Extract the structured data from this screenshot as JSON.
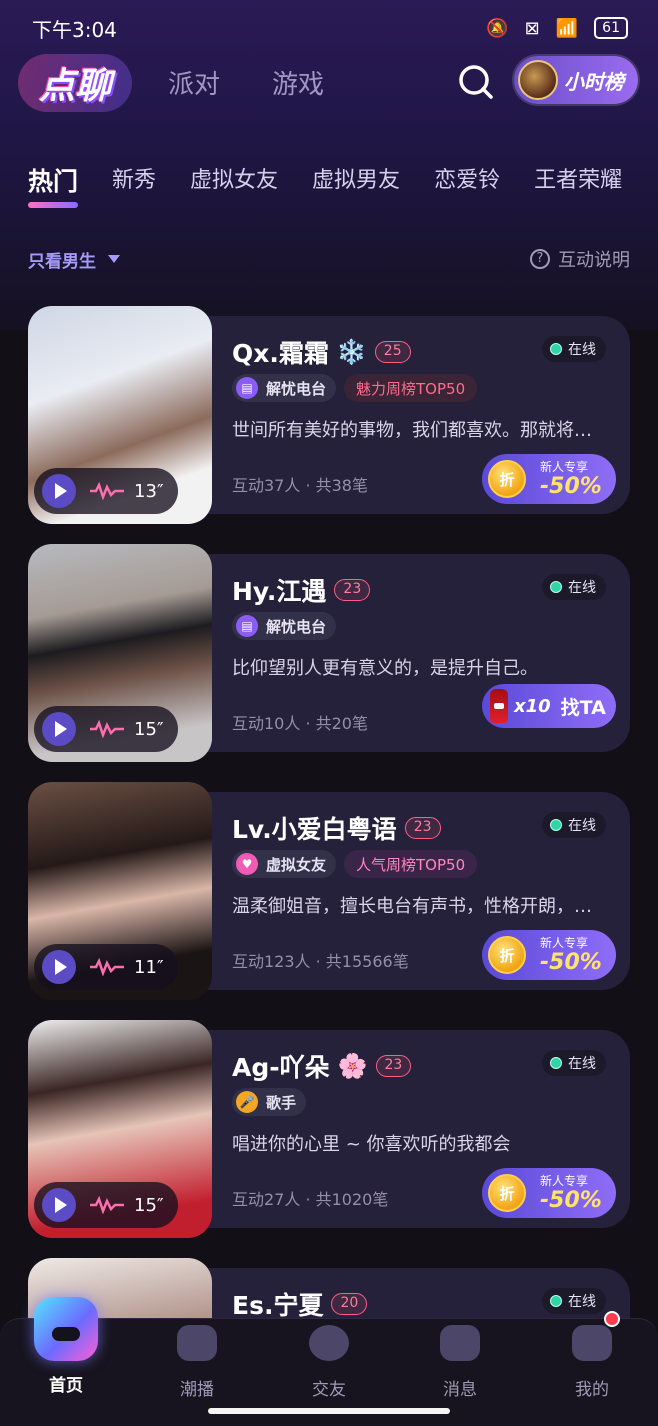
{
  "status_bar": {
    "time": "下午3:04",
    "battery": "61"
  },
  "header": {
    "logo": "点聊",
    "nav": [
      "派对",
      "游戏"
    ],
    "rank_label": "小时榜"
  },
  "categories": [
    "热门",
    "新秀",
    "虚拟女友",
    "虚拟男友",
    "恋爱铃",
    "王者荣耀"
  ],
  "filter": {
    "gender": "只看男生",
    "help": "互动说明"
  },
  "cards": [
    {
      "name": "Qx.霜霜",
      "emoji": "❄️",
      "level": "25",
      "online": "在线",
      "tags": [
        "解忧电台"
      ],
      "rank_tag": "魅力周榜TOP50",
      "desc": "世间所有美好的事物，我们都喜欢。那就将…",
      "stats": "互动37人 · 共38笔",
      "duration": "13″",
      "promo_sub": "新人专享",
      "promo_main": "-50%"
    },
    {
      "name": "Hy.江遇",
      "level": "23",
      "online": "在线",
      "tags": [
        "解忧电台"
      ],
      "desc": "比仰望别人更有意义的，是提升自己。",
      "stats": "互动10人 · 共20笔",
      "duration": "15″",
      "promo_count": "x10",
      "promo_label": "找TA"
    },
    {
      "name": "Lv.小爱白粤语",
      "level": "23",
      "online": "在线",
      "tags": [
        "虚拟女友"
      ],
      "rank_tag": "人气周榜TOP50",
      "desc": "温柔御姐音，擅长电台有声书，性格开朗，…",
      "stats": "互动123人 · 共15566笔",
      "duration": "11″",
      "promo_sub": "新人专享",
      "promo_main": "-50%"
    },
    {
      "name": "Ag-吖朵",
      "emoji": "🌸",
      "level": "23",
      "online": "在线",
      "tags": [
        "歌手"
      ],
      "desc": "唱进你的心里 ~ 你喜欢听的我都会",
      "stats": "互动27人 · 共1020笔",
      "duration": "15″",
      "promo_sub": "新人专享",
      "promo_main": "-50%"
    },
    {
      "name": "Es.宁夏",
      "level": "20",
      "online": "在线"
    }
  ],
  "promo_coin": "折",
  "tabbar": [
    "首页",
    "潮播",
    "交友",
    "消息",
    "我的"
  ]
}
